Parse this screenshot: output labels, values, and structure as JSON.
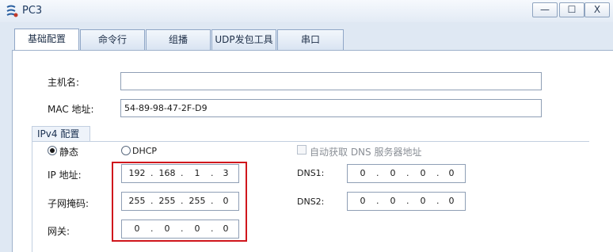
{
  "window": {
    "title": "PC3",
    "buttons": {
      "minimize": "—",
      "maximize": "☐",
      "close": "X"
    }
  },
  "tabs": [
    {
      "label": "基础配置",
      "active": true
    },
    {
      "label": "命令行",
      "active": false
    },
    {
      "label": "组播",
      "active": false
    },
    {
      "label": "UDP发包工具",
      "active": false
    },
    {
      "label": "串口",
      "active": false
    }
  ],
  "basic": {
    "hostname_label": "主机名:",
    "hostname_value": "",
    "mac_label": "MAC 地址:",
    "mac_value": "54-89-98-47-2F-D9"
  },
  "ipv4": {
    "group_title": "IPv4 配置",
    "static_label": "静态",
    "dhcp_label": "DHCP",
    "mode": "static",
    "auto_dns_label": "自动获取 DNS 服务器地址",
    "auto_dns_checked": false,
    "ip_label": "IP 地址:",
    "ip": [
      "192",
      "168",
      "1",
      "3"
    ],
    "mask_label": "子网掩码:",
    "mask": [
      "255",
      "255",
      "255",
      "0"
    ],
    "gateway_label": "网关:",
    "gateway": [
      "0",
      "0",
      "0",
      "0"
    ],
    "dns1_label": "DNS1:",
    "dns1": [
      "0",
      "0",
      "0",
      "0"
    ],
    "dns2_label": "DNS2:",
    "dns2": [
      "0",
      "0",
      "0",
      "0"
    ]
  },
  "colors": {
    "highlight": "#d0161c",
    "accent": "#1f3a60"
  }
}
